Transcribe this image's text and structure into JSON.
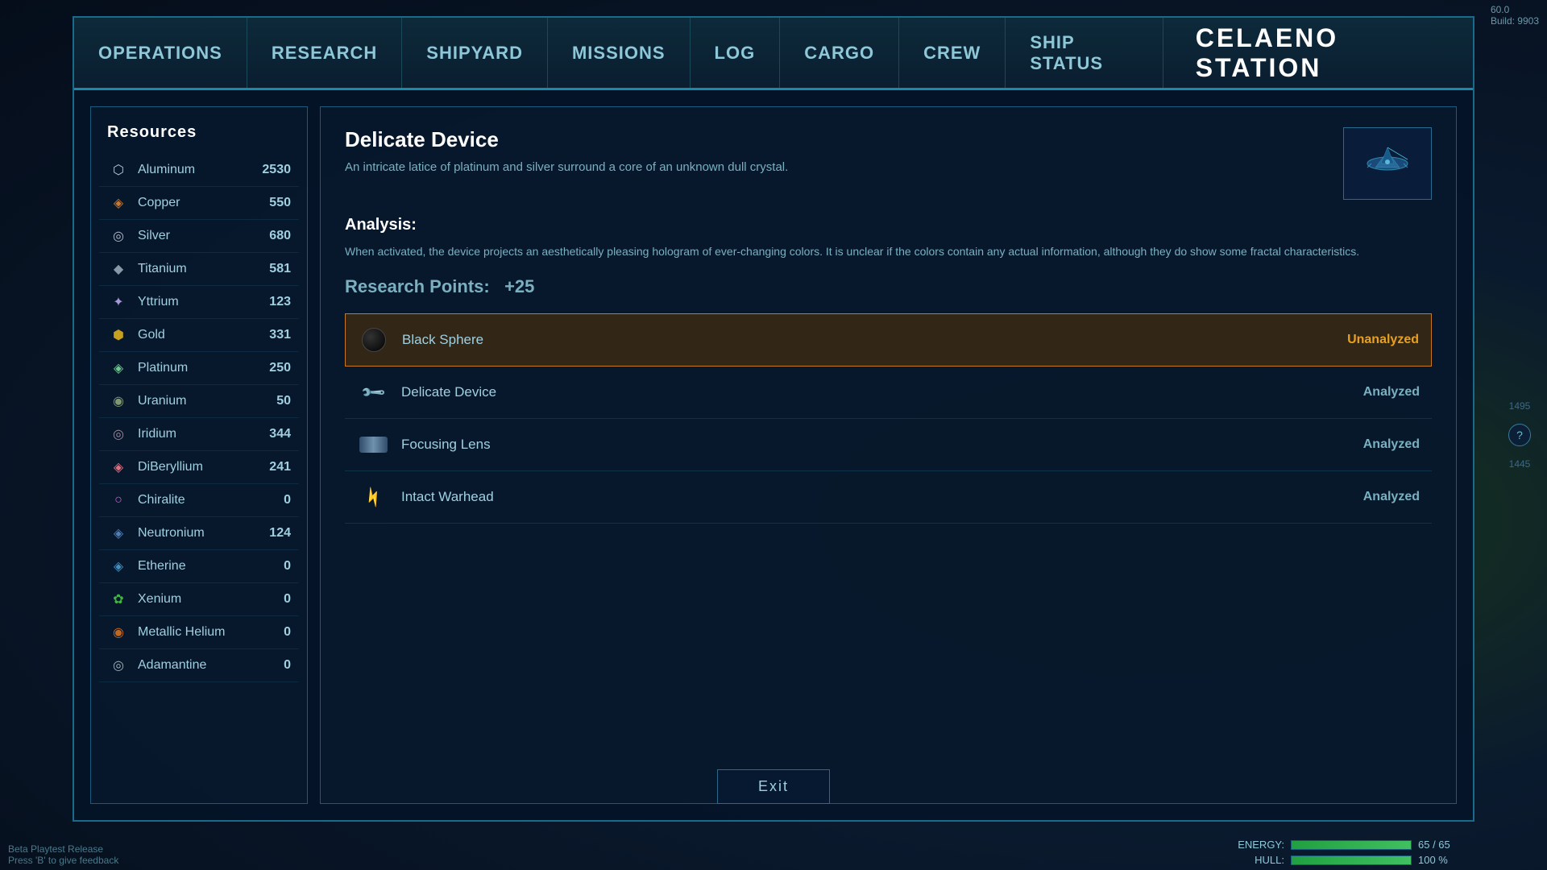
{
  "meta": {
    "fps": "60.0",
    "build": "Build: 9903"
  },
  "station_title": "CELAENO STATION",
  "nav": {
    "items": [
      {
        "id": "operations",
        "label": "Operations"
      },
      {
        "id": "research",
        "label": "Research"
      },
      {
        "id": "shipyard",
        "label": "Shipyard"
      },
      {
        "id": "missions",
        "label": "Missions"
      },
      {
        "id": "log",
        "label": "Log"
      },
      {
        "id": "cargo",
        "label": "Cargo"
      },
      {
        "id": "crew",
        "label": "Crew"
      },
      {
        "id": "ship-status",
        "label": "Ship Status"
      }
    ]
  },
  "resources": {
    "title": "Resources",
    "items": [
      {
        "name": "Aluminum",
        "amount": "2530",
        "icon": "⬡",
        "color": "#b0c8d8"
      },
      {
        "name": "Copper",
        "amount": "550",
        "icon": "◈",
        "color": "#c87830"
      },
      {
        "name": "Silver",
        "amount": "680",
        "icon": "◎",
        "color": "#b0b8c8"
      },
      {
        "name": "Titanium",
        "amount": "581",
        "icon": "◆",
        "color": "#8898a8"
      },
      {
        "name": "Yttrium",
        "amount": "123",
        "icon": "✦",
        "color": "#a898d8"
      },
      {
        "name": "Gold",
        "amount": "331",
        "icon": "⬢",
        "color": "#c8a020"
      },
      {
        "name": "Platinum",
        "amount": "250",
        "icon": "◈",
        "color": "#70c890"
      },
      {
        "name": "Uranium",
        "amount": "50",
        "icon": "◉",
        "color": "#809870"
      },
      {
        "name": "Iridium",
        "amount": "344",
        "icon": "◎",
        "color": "#a08898"
      },
      {
        "name": "DiBeryllium",
        "amount": "241",
        "icon": "◈",
        "color": "#e07080"
      },
      {
        "name": "Chiralite",
        "amount": "0",
        "icon": "○",
        "color": "#d060d0"
      },
      {
        "name": "Neutronium",
        "amount": "124",
        "icon": "◈",
        "color": "#5080b8"
      },
      {
        "name": "Etherine",
        "amount": "0",
        "icon": "◈",
        "color": "#4090c0"
      },
      {
        "name": "Xenium",
        "amount": "0",
        "icon": "✿",
        "color": "#40b840"
      },
      {
        "name": "Metallic Helium",
        "amount": "0",
        "icon": "◉",
        "color": "#c06820"
      },
      {
        "name": "Adamantine",
        "amount": "0",
        "icon": "◎",
        "color": "#a0b0b8"
      }
    ]
  },
  "detail": {
    "title": "Delicate Device",
    "description": "An intricate latice of platinum and silver surround a core of an unknown dull crystal.",
    "analysis_title": "Analysis:",
    "analysis_text": "When activated, the device projects an aesthetically pleasing hologram of ever-changing colors. It is unclear if the colors contain any actual information, although they do show some fractal characteristics.",
    "research_points_label": "Research Points:",
    "research_points_value": "+25"
  },
  "artifact_list": {
    "items": [
      {
        "id": "black-sphere",
        "name": "Black Sphere",
        "status": "Unanalyzed",
        "selected": true,
        "type": "sphere"
      },
      {
        "id": "delicate-device",
        "name": "Delicate Device",
        "status": "Analyzed",
        "selected": false,
        "type": "tool"
      },
      {
        "id": "focusing-lens",
        "name": "Focusing Lens",
        "status": "Analyzed",
        "selected": false,
        "type": "lens"
      },
      {
        "id": "intact-warhead",
        "name": "Intact Warhead",
        "status": "Analyzed",
        "selected": false,
        "type": "tool"
      }
    ]
  },
  "exit_button": {
    "label": "Exit"
  },
  "hud": {
    "energy_label": "ENERGY:",
    "energy_value": "65 / 65",
    "energy_percent": 100,
    "hull_label": "HULL:",
    "hull_value": "100 %",
    "hull_percent": 100
  },
  "side": {
    "number1": "1495",
    "number2": "1445",
    "help": "?"
  },
  "beta_text": "Beta Playtest Release",
  "feedback_text": "Press 'B' to give feedback"
}
